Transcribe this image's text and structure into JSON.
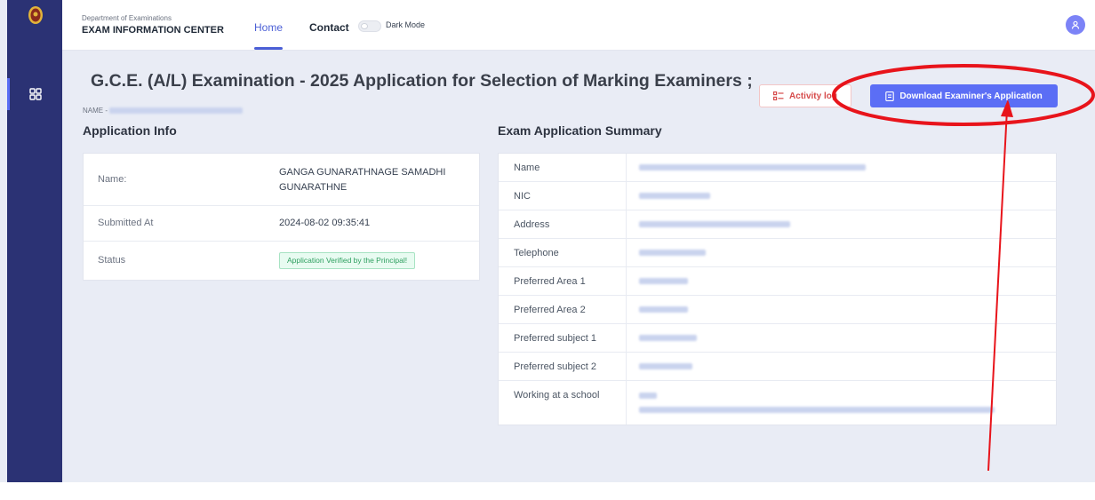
{
  "header": {
    "department": "Department of Examinations",
    "center": "EXAM INFORMATION CENTER",
    "nav": {
      "home": "Home",
      "contact": "Contact",
      "dark_mode": "Dark Mode"
    },
    "avatar_icon": "user-icon"
  },
  "page": {
    "title": "G.C.E. (A/L) Examination - 2025 Application for Selection of Marking Examiners ;",
    "name_prefix": "NAME -",
    "activity_log": "Activity log",
    "download": "Download Examiner's Application"
  },
  "application_info": {
    "title": "Application Info",
    "rows": [
      {
        "label": "Name:",
        "value": "GANGA GUNARATHNAGE SAMADHI GUNARATHNE"
      },
      {
        "label": "Submitted At",
        "value": "2024-08-02 09:35:41"
      },
      {
        "label": "Status",
        "value": "Application Verified by the Principal!"
      }
    ]
  },
  "summary": {
    "title": "Exam Application Summary",
    "rows": [
      {
        "label": "Name"
      },
      {
        "label": "NIC"
      },
      {
        "label": "Address"
      },
      {
        "label": "Telephone"
      },
      {
        "label": "Preferred Area 1"
      },
      {
        "label": "Preferred Area 2"
      },
      {
        "label": "Preferred subject 1"
      },
      {
        "label": "Preferred subject 2"
      },
      {
        "label": "Working at a school"
      }
    ]
  },
  "colors": {
    "sidebar": "#2b3274",
    "accent": "#5b6ef5",
    "activity": "#d64b4b",
    "status_green": "#2e9f5f",
    "annotation_red": "#e8141b"
  }
}
